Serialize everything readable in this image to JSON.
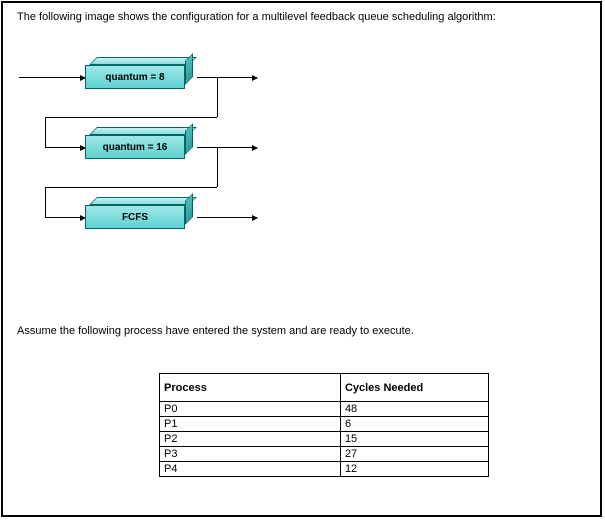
{
  "intro_text": "The following image shows the configuration for a multilevel feedback queue scheduling algorithm:",
  "queues": {
    "q1_label": "quantum = 8",
    "q2_label": "quantum = 16",
    "q3_label": "FCFS"
  },
  "assume_text": "Assume the following process have entered the system and are ready to execute.",
  "table": {
    "col_process": "Process",
    "col_cycles": "Cycles Needed",
    "rows": [
      {
        "process": "P0",
        "cycles": "48"
      },
      {
        "process": "P1",
        "cycles": "6"
      },
      {
        "process": "P2",
        "cycles": "15"
      },
      {
        "process": "P3",
        "cycles": "27"
      },
      {
        "process": "P4",
        "cycles": "12"
      }
    ]
  }
}
